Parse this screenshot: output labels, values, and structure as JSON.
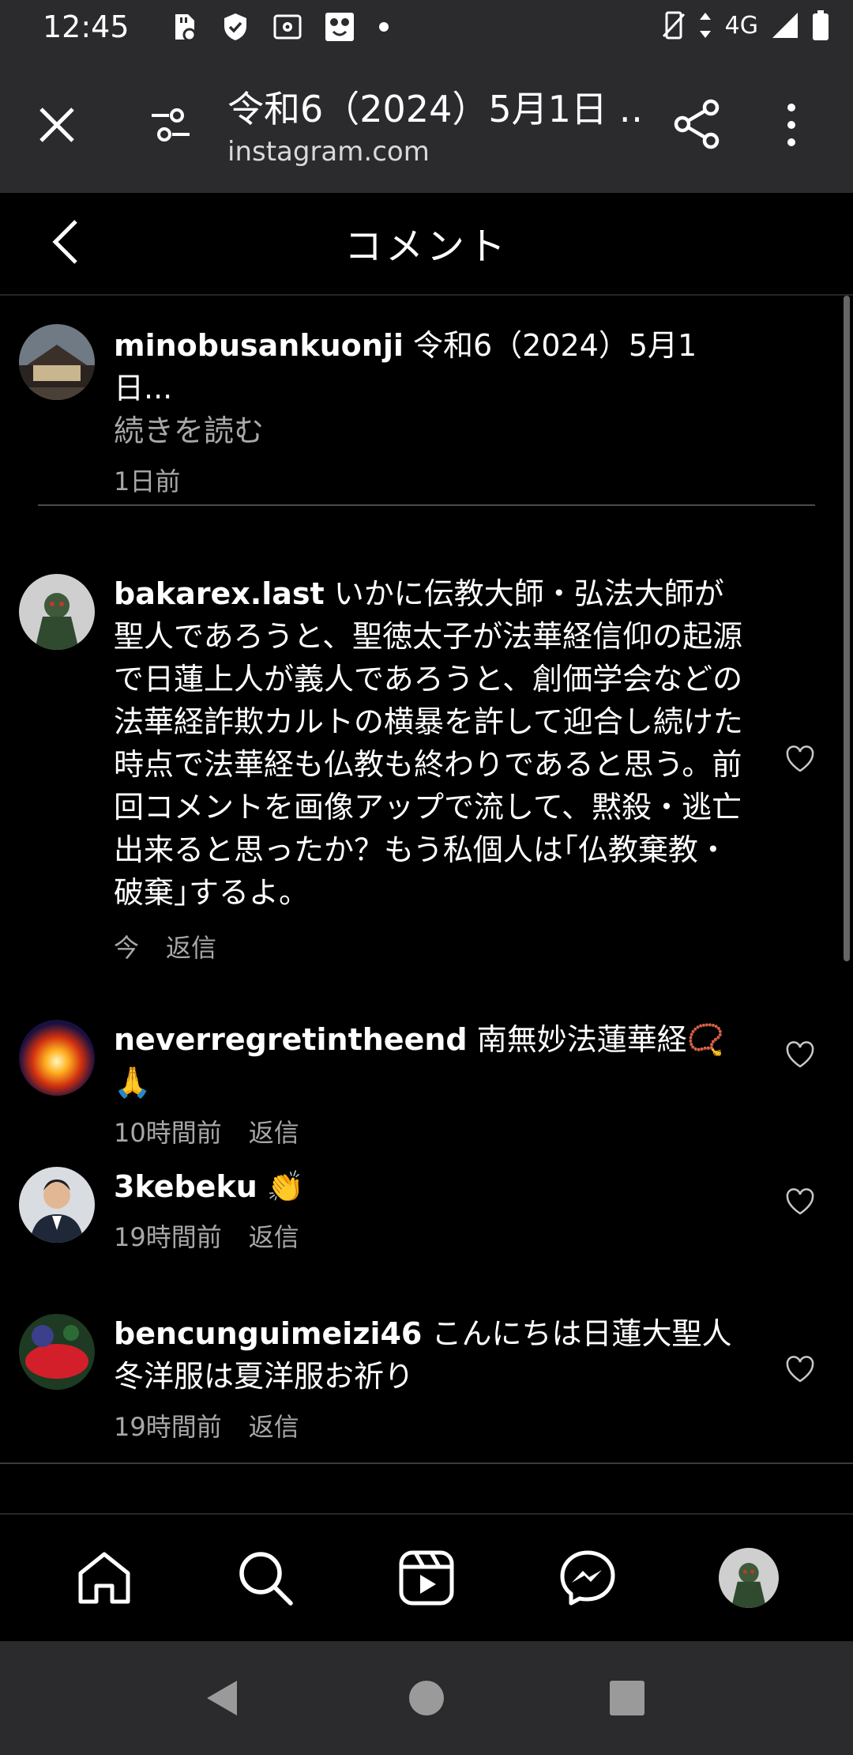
{
  "status_bar": {
    "time": "12:45",
    "network": "4G",
    "icons": [
      "sd-card-icon",
      "shield-icon",
      "settings-box-icon",
      "app-face-icon",
      "dot-icon",
      "vibrate-icon",
      "data-arrows-icon",
      "signal-icon",
      "battery-icon"
    ]
  },
  "browser": {
    "page_title": "令和6（2024）5月1日 …",
    "url": "instagram.com"
  },
  "comments_header": {
    "title": "コメント"
  },
  "caption": {
    "username": "minobusankuonji",
    "text": " 令和6（2024）5月1日...",
    "read_more": "続きを読む",
    "time": "1日前"
  },
  "comments": [
    {
      "username": "bakarex.last",
      "text": " いかに伝教大師・弘法大師が聖人であろうと、聖徳太子が法華経信仰の起源で日蓮上人が義人であろうと、創価学会などの法華経詐欺カルトの横暴を許して迎合し続けた時点で法華経も仏教も終わりであると思う。前回コメントを画像アップで流して、黙殺・逃亡出来ると思ったか？もう私個人は｢仏教棄教・破棄｣するよ。",
      "time": "今",
      "reply": "返信"
    },
    {
      "username": "neverregretintheend",
      "text": " 南無妙法蓮華経📿🙏",
      "time": "10時間前",
      "reply": "返信"
    },
    {
      "username": "3kebeku",
      "text": " 👏",
      "time": "19時間前",
      "reply": "返信"
    },
    {
      "username": "bencunguimeizi46",
      "text": " こんにちは日蓮大聖人冬洋服は夏洋服お祈り",
      "time": "19時間前",
      "reply": "返信"
    }
  ],
  "bottom_nav": [
    "home-icon",
    "search-icon",
    "reels-icon",
    "messenger-icon",
    "profile-avatar"
  ],
  "colors": {
    "background": "#000000",
    "browser_bar": "#2b2b2d",
    "secondary_text": "#a8a8a8"
  }
}
